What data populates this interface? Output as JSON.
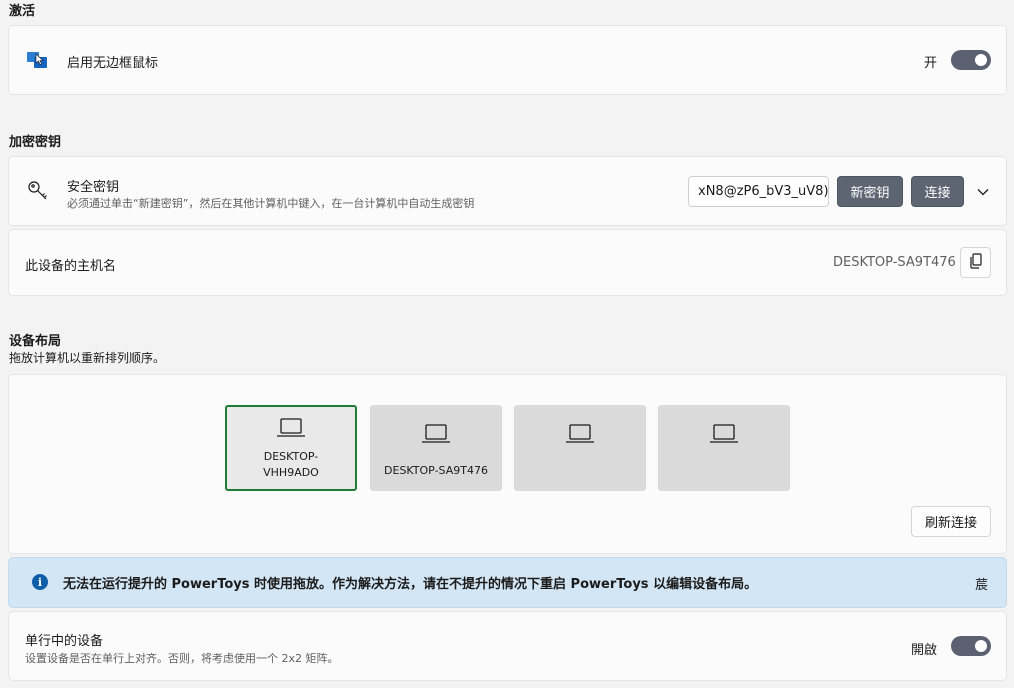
{
  "activation": {
    "section_title": "激活",
    "enable_label": "启用无边框鼠标",
    "toggle_state": "开"
  },
  "encryption": {
    "section_title": "加密密钥",
    "security_key_label": "安全密钥",
    "security_key_desc": "必须通过单击“新建密钥”，然后在其他计算机中键入，在一台计算机中自动生成密钥",
    "key_value": "xN8@zP6_bV3_uV8)",
    "new_key_button": "新密钥",
    "connect_button": "连接",
    "hostname_label": "此设备的主机名",
    "hostname_value": "DESKTOP-SA9T476"
  },
  "layout": {
    "section_title": "设备布局",
    "section_desc": "拖放计算机以重新排列顺序。",
    "devices": [
      {
        "name_line1": "DESKTOP-",
        "name_line2": "VHH9ADO",
        "active": true
      },
      {
        "name_line1": "DESKTOP-SA9T476",
        "name_line2": "",
        "active": false
      },
      {
        "name_line1": "",
        "name_line2": "",
        "active": false
      },
      {
        "name_line1": "",
        "name_line2": "",
        "active": false
      }
    ],
    "refresh_button": "刷新连接"
  },
  "info_bar": {
    "message": "无法在运行提升的 PowerToys 时使用拖放。作为解决方法，请在不提升的情况下重启 PowerToys 以编辑设备布局。",
    "close_glyph": "莀"
  },
  "single_row": {
    "label": "单行中的设备",
    "desc": "设置设备是否在单行上对齐。否则，将考虑使用一个 2x2 矩阵。",
    "toggle_state": "開啟"
  },
  "colors": {
    "accent_toggle": "#5b6170",
    "active_border": "#1e7d32",
    "info_background": "#d3e6f5",
    "info_icon": "#0f5ea8"
  }
}
